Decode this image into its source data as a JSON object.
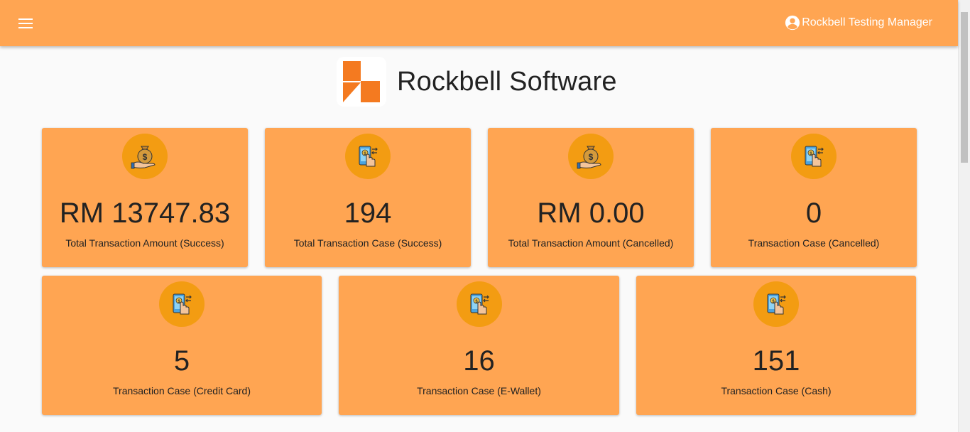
{
  "header": {
    "user_name": "Rockbell Testing Manager",
    "bar_color": "#ffa552"
  },
  "brand": {
    "name": "Software",
    "prefix": "Rockbell",
    "logo_colors": [
      "#f47a20",
      "#ffffff"
    ]
  },
  "cards": [
    {
      "value": "RM 13747.83",
      "label": "Total Transaction Amount (Success)",
      "icon": "money-bag-hand-icon"
    },
    {
      "value": "194",
      "label": "Total Transaction Case (Success)",
      "icon": "mobile-payment-icon"
    },
    {
      "value": "RM 0.00",
      "label": "Total Transaction Amount (Cancelled)",
      "icon": "money-bag-hand-icon"
    },
    {
      "value": "0",
      "label": "Transaction Case (Cancelled)",
      "icon": "mobile-payment-icon"
    },
    {
      "value": "5",
      "label": "Transaction Case (Credit Card)",
      "icon": "mobile-payment-icon"
    },
    {
      "value": "16",
      "label": "Transaction Case (E-Wallet)",
      "icon": "mobile-payment-icon"
    },
    {
      "value": "151",
      "label": "Transaction Case (Cash)",
      "icon": "mobile-payment-icon"
    }
  ],
  "colors": {
    "card_bg": "#ffa552",
    "icon_circle": "#f39c12",
    "page_bg": "#fafafa"
  }
}
